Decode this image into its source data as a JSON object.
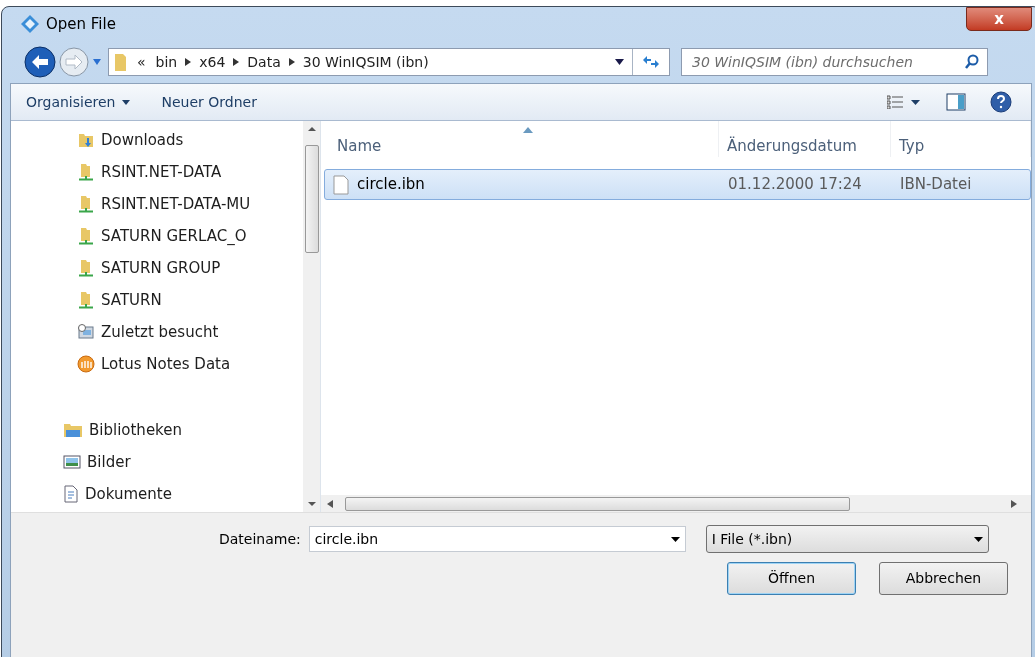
{
  "window": {
    "title": "Open File",
    "close": "x"
  },
  "address": {
    "overflow": "«",
    "crumbs": [
      "bin",
      "x64",
      "Data",
      "30 WinIQSIM (ibn)"
    ]
  },
  "search": {
    "placeholder": "30 WinIQSIM (ibn) durchsuchen"
  },
  "toolbar": {
    "buttons": [
      "Organisieren",
      "Neuer Ordner"
    ]
  },
  "sidebar": {
    "items": [
      {
        "label": "Downloads",
        "kind": "downloads"
      },
      {
        "label": "RSINT.NET-DATA",
        "kind": "share"
      },
      {
        "label": "RSINT.NET-DATA-MU",
        "kind": "share"
      },
      {
        "label": "SATURN GERLAC_O",
        "kind": "share"
      },
      {
        "label": "SATURN GROUP",
        "kind": "share"
      },
      {
        "label": "SATURN",
        "kind": "share"
      },
      {
        "label": "Zuletzt besucht",
        "kind": "recent"
      },
      {
        "label": "Lotus Notes Data",
        "kind": "lotus"
      },
      {
        "label": "Bibliotheken",
        "kind": "library",
        "children": [
          {
            "label": "Bilder",
            "kind": "pictures"
          },
          {
            "label": "Dokumente",
            "kind": "documents"
          }
        ]
      }
    ]
  },
  "table": {
    "columns": [
      "Name",
      "Änderungsdatum",
      "Typ"
    ],
    "rows": [
      {
        "name": "circle.ibn",
        "date": "01.12.2000 17:24",
        "type": "IBN-Datei",
        "selected": true
      }
    ]
  },
  "footer": {
    "filename_label": "Dateiname:",
    "filename": "circle.ibn",
    "filter": "I File (*.ibn)",
    "buttons": [
      "Öffnen",
      "Abbrechen"
    ]
  }
}
